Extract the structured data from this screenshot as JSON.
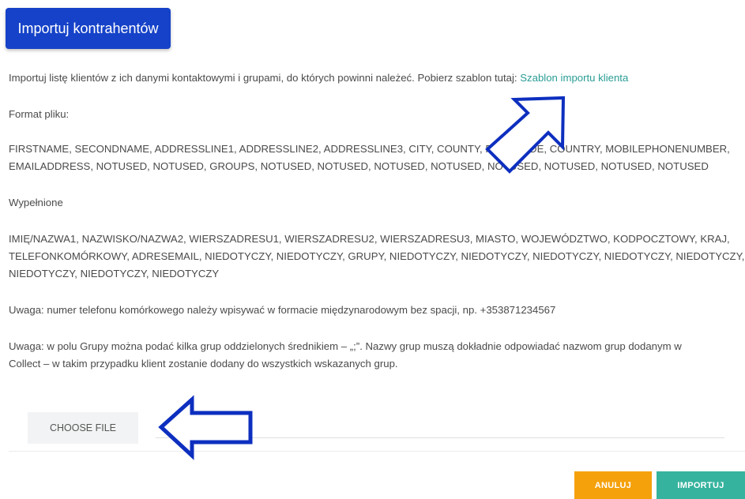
{
  "header": {
    "title": "Importuj kontrahentów"
  },
  "intro": {
    "text": "Importuj listę klientów z ich danymi kontaktowymi i grupami, do których powinni należeć. Pobierz szablon tutaj: ",
    "link": "Szablon importu klienta"
  },
  "format": {
    "heading": "Format pliku:",
    "line1": "FIRSTNAME, SECONDNAME, ADDRESSLINE1, ADDRESSLINE2, ADDRESSLINE3, CITY, COUNTY, POSTCODE, COUNTRY, MOBILEPHONENUMBER,",
    "line2": "EMAILADDRESS, NOTUSED, NOTUSED, GROUPS, NOTUSED, NOTUSED, NOTUSED, NOTUSED, NOTUSED, NOTUSED, NOTUSED, NOTUSED"
  },
  "filled": {
    "heading": "Wypełnione",
    "line1": "IMIĘ/NAZWA1, NAZWISKO/NAZWA2, WIERSZADRESU1, WIERSZADRESU2, WIERSZADRESU3, MIASTO, WOJEWÓDZTWO, KODPOCZTOWY, KRAJ,",
    "line2": "TELEFONKOMÓRKOWY, ADRESEMAIL, NIEDOTYCZY, NIEDOTYCZY, GRUPY, NIEDOTYCZY, NIEDOTYCZY, NIEDOTYCZY, NIEDOTYCZY, NIEDOTYCZY,",
    "line3": "NIEDOTYCZY, NIEDOTYCZY, NIEDOTYCZY"
  },
  "notes": {
    "phone": "Uwaga: numer telefonu komórkowego należy wpisywać w formacie międzynarodowym bez spacji, np. +353871234567",
    "groups_line1": "Uwaga: w polu Grupy można podać kilka grup oddzielonych średnikiem – „;”. Nazwy grup muszą dokładnie odpowiadać nazwom grup dodanym w",
    "groups_line2": "Collect – w takim przypadku klient zostanie dodany do wszystkich wskazanych grup."
  },
  "file": {
    "choose_label": "CHOOSE FILE"
  },
  "actions": {
    "cancel_label": "ANULUJ",
    "import_label": "IMPORTUJ"
  },
  "colors": {
    "title_bg": "#1542c8",
    "link": "#2a9d95",
    "cancel": "#f5a10c",
    "import": "#36b39e",
    "annotation_arrow": "#0d2fbf"
  },
  "annotations": [
    "arrow-pointing-to-template-link",
    "arrow-pointing-to-choose-file"
  ]
}
